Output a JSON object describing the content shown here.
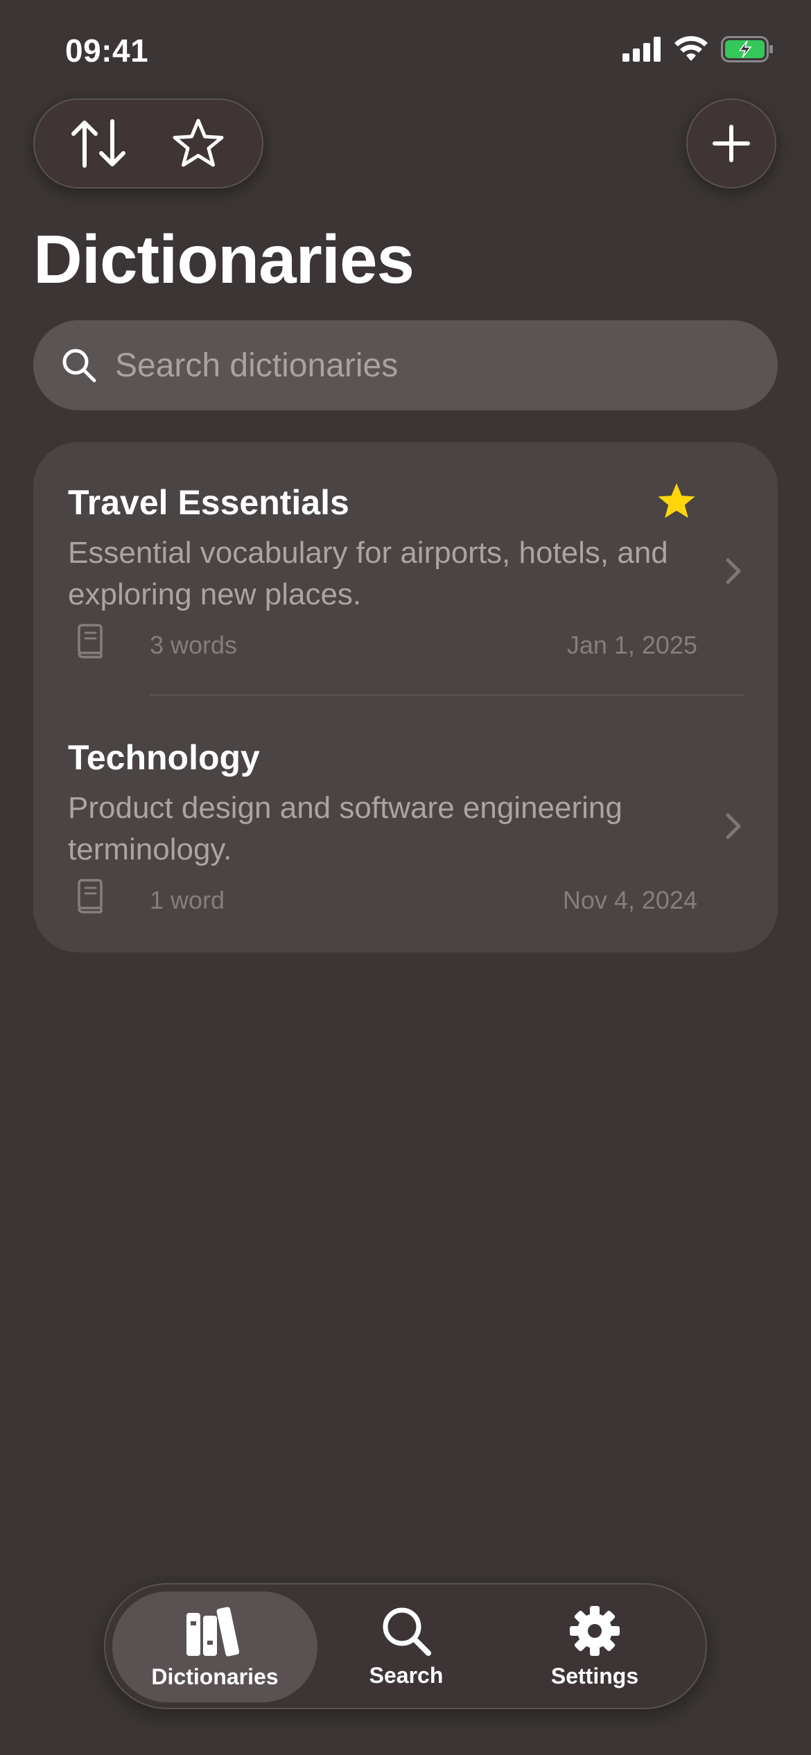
{
  "status_bar": {
    "time": "09:41"
  },
  "toolbar": {
    "sort_icon": "arrow-up-down-icon",
    "favorites_icon": "star-outline-icon",
    "add_icon": "plus-icon"
  },
  "page": {
    "title": "Dictionaries"
  },
  "search": {
    "placeholder": "Search dictionaries"
  },
  "dictionaries": [
    {
      "title": "Travel Essentials",
      "description": "Essential vocabulary for airports, hotels, and exploring new places.",
      "count": "3 words",
      "date": "Jan 1, 2025",
      "favorite": true
    },
    {
      "title": "Technology",
      "description": "Product design and software engineering terminology.",
      "count": "1 word",
      "date": "Nov 4, 2024",
      "favorite": false
    }
  ],
  "tabs": [
    {
      "label": "Dictionaries",
      "icon": "books-icon",
      "active": true
    },
    {
      "label": "Search",
      "icon": "magnifier-icon",
      "active": false
    },
    {
      "label": "Settings",
      "icon": "gear-icon",
      "active": false
    }
  ],
  "colors": {
    "background": "#3b3535",
    "card": "#4a4444",
    "search_field": "#5a5454",
    "favorite_star": "#ffd60a",
    "battery": "#34c759"
  }
}
